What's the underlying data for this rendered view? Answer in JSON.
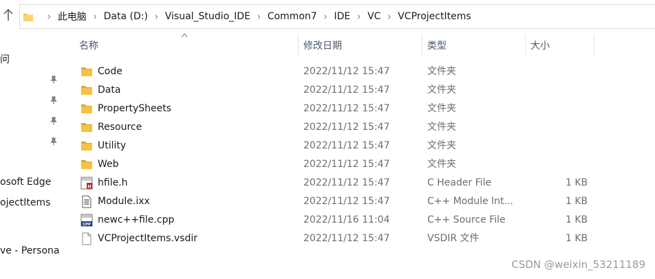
{
  "address_bar": {
    "crumbs": [
      "此电脑",
      "Data (D:)",
      "Visual_Studio_IDE",
      "Common7",
      "IDE",
      "VC",
      "VCProjectItems"
    ]
  },
  "nav_pane": {
    "items": [
      "问",
      "osoft Edge",
      "ojectItems",
      "ve - Persona"
    ]
  },
  "columns": {
    "name": "名称",
    "date": "修改日期",
    "type": "类型",
    "size": "大小"
  },
  "files": [
    {
      "name": "Code",
      "date": "2022/11/12 15:47",
      "type": "文件夹",
      "size": "",
      "icon": "folder-icon"
    },
    {
      "name": "Data",
      "date": "2022/11/12 15:47",
      "type": "文件夹",
      "size": "",
      "icon": "folder-icon"
    },
    {
      "name": "PropertySheets",
      "date": "2022/11/12 15:47",
      "type": "文件夹",
      "size": "",
      "icon": "folder-icon"
    },
    {
      "name": "Resource",
      "date": "2022/11/12 15:47",
      "type": "文件夹",
      "size": "",
      "icon": "folder-icon"
    },
    {
      "name": "Utility",
      "date": "2022/11/12 15:47",
      "type": "文件夹",
      "size": "",
      "icon": "folder-icon"
    },
    {
      "name": "Web",
      "date": "2022/11/12 15:47",
      "type": "文件夹",
      "size": "",
      "icon": "folder-icon"
    },
    {
      "name": "hfile.h",
      "date": "2022/11/12 15:47",
      "type": "C Header File",
      "size": "1 KB",
      "icon": "header-file-icon"
    },
    {
      "name": "Module.ixx",
      "date": "2022/11/12 15:47",
      "type": "C++ Module Int...",
      "size": "1 KB",
      "icon": "text-file-icon"
    },
    {
      "name": "newc++file.cpp",
      "date": "2022/11/16 11:04",
      "type": "C++ Source File",
      "size": "1 KB",
      "icon": "cpp-file-icon"
    },
    {
      "name": "VCProjectItems.vsdir",
      "date": "2022/11/12 15:47",
      "type": "VSDIR 文件",
      "size": "1 KB",
      "icon": "blank-file-icon"
    }
  ],
  "watermark": "CSDN @weixin_53211189",
  "colors": {
    "folder": "#f5c342",
    "folder_dark": "#e0a82e",
    "header_red": "#c62828",
    "cpp_blue": "#1e3a8a",
    "secondary_text": "#6d6d6d"
  }
}
